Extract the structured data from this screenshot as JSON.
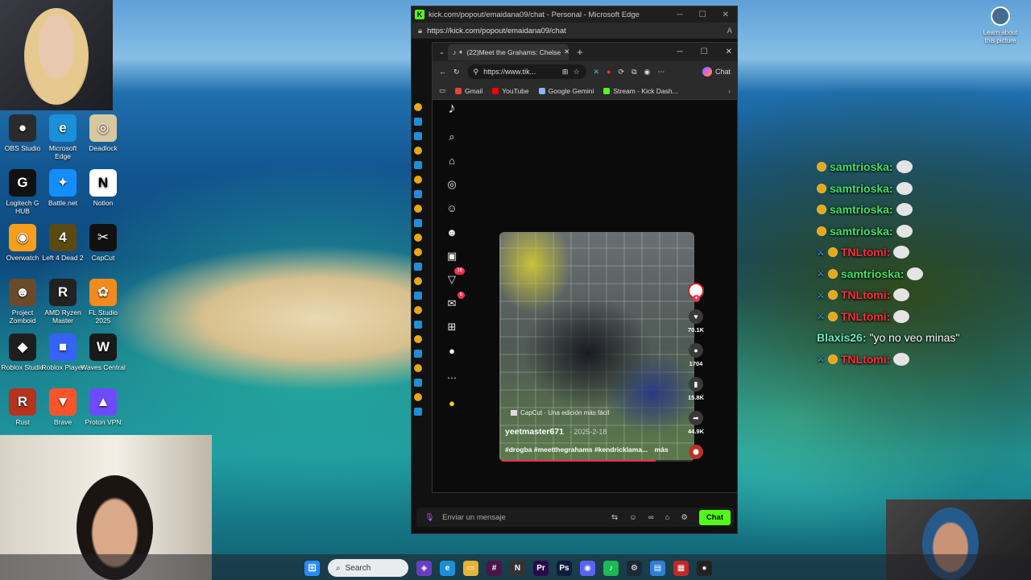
{
  "desktop": {
    "icons": [
      {
        "label": "OBS Studio",
        "glyph": "●",
        "color": "#2b2b2b"
      },
      {
        "label": "Microsoft Edge",
        "glyph": "e",
        "color": "#1b8fd8"
      },
      {
        "label": "Deadlock",
        "glyph": "◎",
        "color": "#d8c8a0"
      },
      {
        "label": "Logitech G HUB",
        "glyph": "G",
        "color": "#111111"
      },
      {
        "label": "Battle.net",
        "glyph": "✦",
        "color": "#148eff"
      },
      {
        "label": "Notion",
        "glyph": "N",
        "color": "#ffffff"
      },
      {
        "label": "Overwatch",
        "glyph": "◉",
        "color": "#f99e1a"
      },
      {
        "label": "Left 4 Dead 2",
        "glyph": "4",
        "color": "#5a4a12"
      },
      {
        "label": "CapCut",
        "glyph": "✂",
        "color": "#111111"
      },
      {
        "label": "Project Zomboid",
        "glyph": "☻",
        "color": "#6b4a2a"
      },
      {
        "label": "AMD Ryzen Master",
        "glyph": "R",
        "color": "#222222"
      },
      {
        "label": "FL Studio 2025",
        "glyph": "✿",
        "color": "#f28b1d"
      },
      {
        "label": "Roblox Studio",
        "glyph": "◆",
        "color": "#1e1e1e"
      },
      {
        "label": "Roblox Player",
        "glyph": "■",
        "color": "#3563f5"
      },
      {
        "label": "Waves Central",
        "glyph": "W",
        "color": "#1a1a1a"
      },
      {
        "label": "Rust",
        "glyph": "R",
        "color": "#b8321e"
      },
      {
        "label": "Brave",
        "glyph": "▼",
        "color": "#fb542b"
      },
      {
        "label": "Proton VPN",
        "glyph": "▲",
        "color": "#6d4aff"
      }
    ],
    "learn_label": "Learn about this picture"
  },
  "edge_outer": {
    "title": "kick.com/popout/emaidana09/chat - Personal - Microsoft Edge",
    "url": "https://kick.com/popout/emaidana09/chat"
  },
  "edge_inner": {
    "tab_title": "(22)Meet the Grahams: Chelse",
    "address": "https://www.tik...",
    "chat_label": "Chat",
    "favorites": [
      {
        "label": "Gmail",
        "color": "#ea4335"
      },
      {
        "label": "YouTube",
        "color": "#ff0000"
      },
      {
        "label": "Google Gemini",
        "color": "#8ab4f8"
      },
      {
        "label": "Stream - Kick Dash...",
        "color": "#53fc18"
      }
    ]
  },
  "tiktok": {
    "sidebar": [
      {
        "name": "search-icon",
        "glyph": "⌕",
        "badge": ""
      },
      {
        "name": "home-icon",
        "glyph": "⌂",
        "badge": ""
      },
      {
        "name": "explore-icon",
        "glyph": "◎",
        "badge": ""
      },
      {
        "name": "following-icon",
        "glyph": "☺",
        "badge": ""
      },
      {
        "name": "friends-icon",
        "glyph": "☻",
        "badge": ""
      },
      {
        "name": "live-icon",
        "glyph": "▣",
        "badge": ""
      },
      {
        "name": "activity-icon",
        "glyph": "▽",
        "badge": "16"
      },
      {
        "name": "messages-icon",
        "glyph": "✉",
        "badge": "6"
      },
      {
        "name": "upload-icon",
        "glyph": "⊞",
        "badge": ""
      },
      {
        "name": "profile-icon",
        "glyph": "●",
        "badge": ""
      },
      {
        "name": "more-icon",
        "glyph": "…",
        "badge": ""
      }
    ],
    "video": {
      "capcut_label": "CapCut · Una edición más fácil",
      "author": "yeetmaster671",
      "date": "· 2025-2-18",
      "tags": "#drogba #meetthegrahams #kendricklama...",
      "more": "más",
      "progress": 0.8
    },
    "actions": {
      "likes": "70.1K",
      "comments": "1704",
      "saves": "15.8K",
      "shares": "44.9K"
    }
  },
  "kick_chat": {
    "placeholder": "Enviar un mensaje",
    "send_label": "Chat"
  },
  "overlay_chat": [
    {
      "user": "samtrioska:",
      "message": "",
      "user_color": "#3fe06a",
      "sword": false
    },
    {
      "user": "samtrioska:",
      "message": "",
      "user_color": "#3fe06a",
      "sword": false
    },
    {
      "user": "samtrioska:",
      "message": "",
      "user_color": "#3fe06a",
      "sword": false
    },
    {
      "user": "samtrioska:",
      "message": "",
      "user_color": "#3fe06a",
      "sword": false
    },
    {
      "user": "TNLtomi:",
      "message": "",
      "user_color": "#ff2b3c",
      "sword": true
    },
    {
      "user": "samtrioska:",
      "message": "",
      "user_color": "#3fe06a",
      "sword": true
    },
    {
      "user": "TNLtomi:",
      "message": "",
      "user_color": "#ff2b3c",
      "sword": true
    },
    {
      "user": "TNLtomi:",
      "message": "",
      "user_color": "#ff2b3c",
      "sword": true
    },
    {
      "user": "Blaxis26:",
      "message": "\"yo no veo minas\"",
      "user_color": "#6ee8c4",
      "sword": false
    },
    {
      "user": "TNLtomi:",
      "message": "",
      "user_color": "#ff2b3c",
      "sword": true
    }
  ],
  "taskbar": {
    "search_label": "Search",
    "apps": [
      {
        "name": "game-icon",
        "glyph": "◈",
        "color": "#6a3dbf"
      },
      {
        "name": "edge-icon",
        "glyph": "e",
        "color": "#1b8fd8"
      },
      {
        "name": "file-explorer-icon",
        "glyph": "▭",
        "color": "#e8b13a"
      },
      {
        "name": "slack-icon",
        "glyph": "#",
        "color": "#4a154b"
      },
      {
        "name": "notion-icon",
        "glyph": "N",
        "color": "#333333"
      },
      {
        "name": "premiere-icon",
        "glyph": "Pr",
        "color": "#2a0a4a"
      },
      {
        "name": "photoshop-icon",
        "glyph": "Ps",
        "color": "#0a1f3a"
      },
      {
        "name": "discord-icon",
        "glyph": "◉",
        "color": "#5865f2"
      },
      {
        "name": "spotify-icon",
        "glyph": "♪",
        "color": "#1db954"
      },
      {
        "name": "steam-icon",
        "glyph": "⚙",
        "color": "#1b2838"
      },
      {
        "name": "monitor-icon",
        "glyph": "▤",
        "color": "#2f7fd6"
      },
      {
        "name": "capture-icon",
        "glyph": "▦",
        "color": "#c22727"
      },
      {
        "name": "obs-taskbar-icon",
        "glyph": "●",
        "color": "#222222"
      }
    ]
  }
}
